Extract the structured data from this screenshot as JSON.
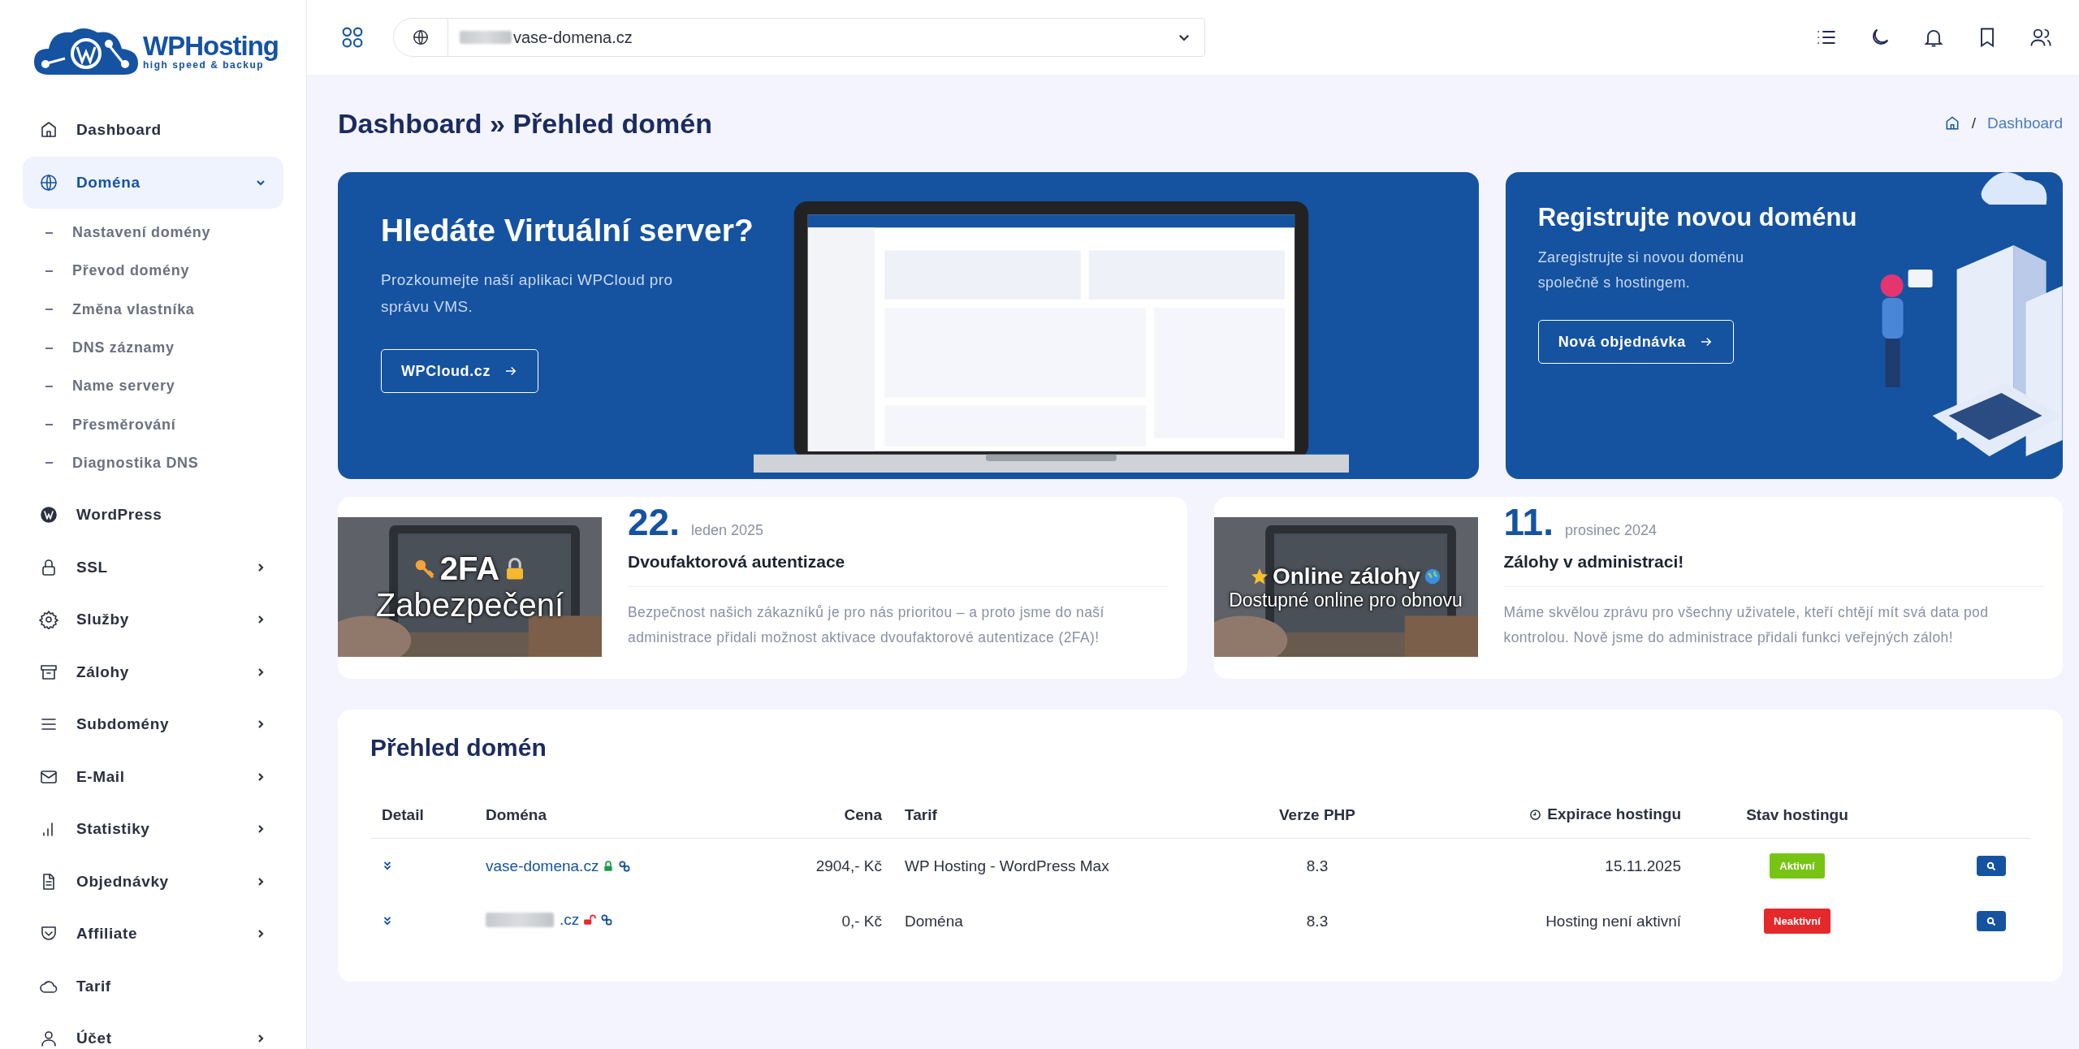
{
  "logo": {
    "name": "WPHosting",
    "tagline": "high speed & backup"
  },
  "sidebar": {
    "items": [
      {
        "label": "Dashboard",
        "kind": "link",
        "selected": false
      },
      {
        "label": "Doména",
        "kind": "group",
        "selected": true,
        "expanded": true,
        "children": [
          {
            "label": "Nastavení domény"
          },
          {
            "label": "Převod domény"
          },
          {
            "label": "Změna vlastníka"
          },
          {
            "label": "DNS záznamy"
          },
          {
            "label": "Name servery"
          },
          {
            "label": "Přesměrování"
          },
          {
            "label": "Diagnostika DNS"
          }
        ]
      },
      {
        "label": "WordPress",
        "kind": "link",
        "selected": false
      },
      {
        "label": "SSL",
        "kind": "group",
        "selected": false,
        "expanded": false
      },
      {
        "label": "Služby",
        "kind": "group",
        "selected": false,
        "expanded": false
      },
      {
        "label": "Zálohy",
        "kind": "group",
        "selected": false,
        "expanded": false
      },
      {
        "label": "Subdomény",
        "kind": "group",
        "selected": false,
        "expanded": false
      },
      {
        "label": "E-Mail",
        "kind": "group",
        "selected": false,
        "expanded": false
      },
      {
        "label": "Statistiky",
        "kind": "group",
        "selected": false,
        "expanded": false
      },
      {
        "label": "Objednávky",
        "kind": "group",
        "selected": false,
        "expanded": false
      },
      {
        "label": "Affiliate",
        "kind": "group",
        "selected": false,
        "expanded": false
      },
      {
        "label": "Tarif",
        "kind": "link",
        "selected": false
      },
      {
        "label": "Účet",
        "kind": "group",
        "selected": false,
        "expanded": false
      }
    ]
  },
  "header": {
    "domain_select": {
      "value": "vase-domena.cz",
      "prefix_hidden": true
    }
  },
  "page_title": "Dashboard » Přehled domén",
  "breadcrumb": [
    "Dashboard"
  ],
  "breadcrumb_separator": "/",
  "promo": {
    "title": "Hledáte Virtuální server?",
    "text": "Prozkoumejte naší aplikaci WPCloud pro správu VMS.",
    "button": "WPCloud.cz"
  },
  "register": {
    "title": "Registrujte novou doménu",
    "text": "Zaregistrujte si novou doménu společně s hostingem.",
    "button": "Nová objednávka"
  },
  "news": [
    {
      "day": "22.",
      "date": "leden 2025",
      "title": "Dvoufaktorová autentizace",
      "text": "Bezpečnost našich zákazníků je pro nás prioritou – a proto jsme do naší administrace přidali možnost aktivace dvoufaktorové autentizace (2FA)!",
      "image_caption": [
        "2FA",
        "Zabezpečení"
      ]
    },
    {
      "day": "11.",
      "date": "prosinec 2024",
      "title": "Zálohy v administraci!",
      "text": "Máme skvělou zprávu pro všechny uživatele, kteří chtějí mít svá data pod kontrolou. Nově jsme do administrace přidali funkci veřejných záloh!",
      "image_caption": [
        "Online zálohy",
        "Dostupné online pro obnovu"
      ]
    }
  ],
  "table": {
    "title": "Přehled domén",
    "columns": [
      "Detail",
      "Doména",
      "Cena",
      "Tarif",
      "Verze PHP",
      "Expirace hostingu",
      "Stav hostingu"
    ],
    "rows": [
      {
        "domain": "vase-domena.cz",
        "ssl": true,
        "price": "2904,- Kč",
        "tariff": "WP Hosting - WordPress Max",
        "php": "8.3",
        "expiry": "15.11.2025",
        "status": "Aktivní",
        "active": true
      },
      {
        "domain": ".cz",
        "prefix_hidden": true,
        "ssl": false,
        "price": "0,- Kč",
        "tariff": "Doména",
        "php": "8.3",
        "expiry": "Hosting není aktivní",
        "status": "Neaktivní",
        "active": false
      }
    ]
  }
}
